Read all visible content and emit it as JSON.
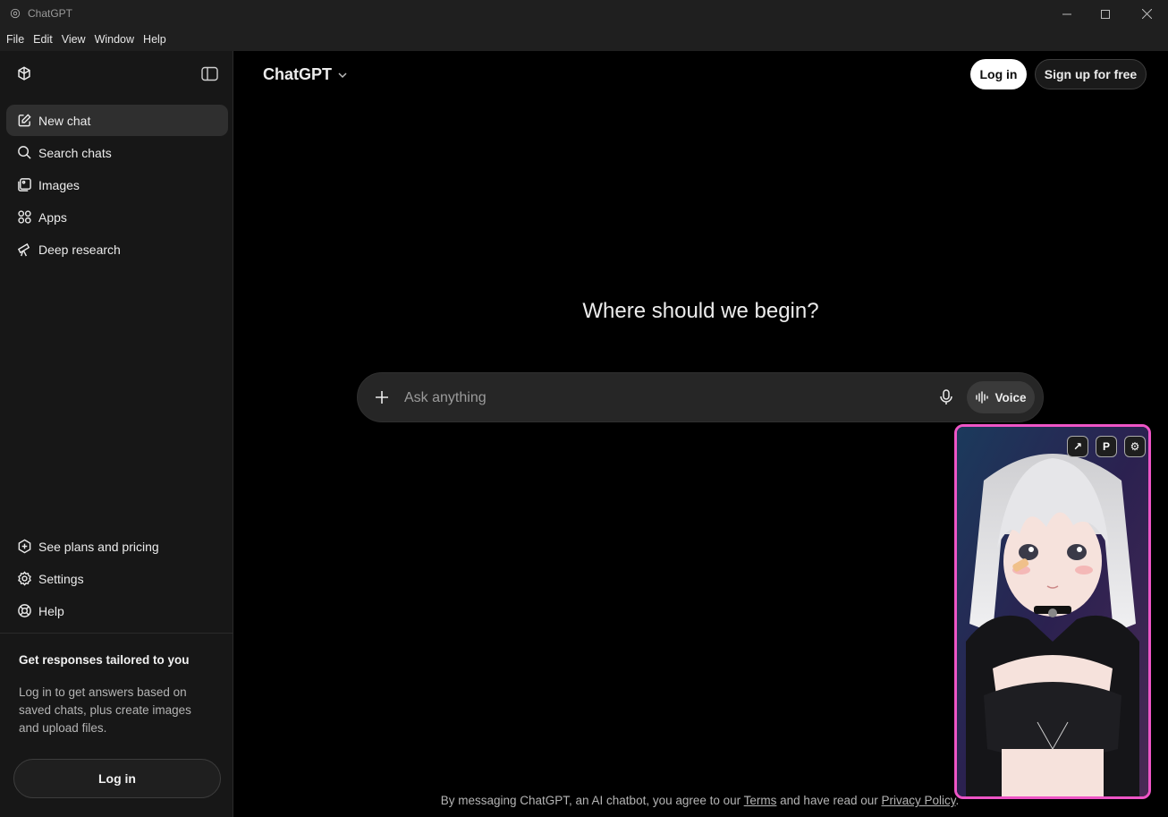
{
  "window": {
    "title": "ChatGPT"
  },
  "menubar": {
    "items": [
      "File",
      "Edit",
      "View",
      "Window",
      "Help"
    ]
  },
  "sidebar": {
    "nav": [
      {
        "label": "New chat",
        "icon": "edit-icon",
        "active": true
      },
      {
        "label": "Search chats",
        "icon": "search-icon"
      },
      {
        "label": "Images",
        "icon": "images-icon"
      },
      {
        "label": "Apps",
        "icon": "apps-icon"
      },
      {
        "label": "Deep research",
        "icon": "telescope-icon"
      }
    ],
    "bottom_nav": [
      {
        "label": "See plans and pricing",
        "icon": "plans-icon"
      },
      {
        "label": "Settings",
        "icon": "gear-icon"
      },
      {
        "label": "Help",
        "icon": "help-icon"
      }
    ],
    "promo": {
      "title": "Get responses tailored to you",
      "text": "Log in to get answers based on saved chats, plus create images and upload files.",
      "login_label": "Log in"
    }
  },
  "header": {
    "model": "ChatGPT",
    "login_label": "Log in",
    "signup_label": "Sign up for free"
  },
  "main": {
    "headline": "Where should we begin?",
    "composer": {
      "placeholder": "Ask anything",
      "voice_label": "Voice"
    },
    "footer": {
      "prefix": "By messaging ChatGPT, an AI chatbot, you agree to our ",
      "terms": "Terms",
      "middle": " and have read our ",
      "privacy": "Privacy Policy",
      "suffix": "."
    }
  },
  "avatar_overlay": {
    "controls": [
      "↗",
      "P",
      "⚙"
    ],
    "border_color": "#ee55c6"
  },
  "colors": {
    "accent_border": "#ee55c6",
    "sidebar_bg": "#171717",
    "main_bg": "#000000"
  }
}
